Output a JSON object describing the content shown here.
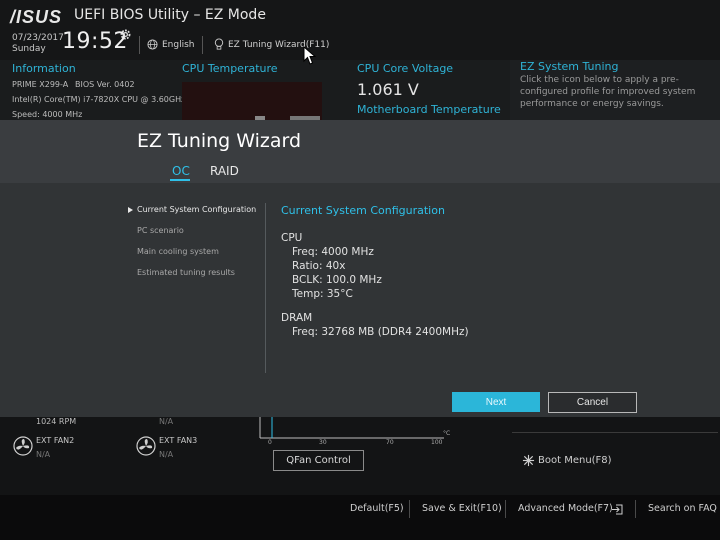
{
  "topbar": {
    "logo": "/ISUS",
    "title": "UEFI BIOS Utility – EZ Mode",
    "date": "07/23/2017",
    "day": "Sunday",
    "time": "19:52",
    "language": "English",
    "wizard_link": "EZ Tuning Wizard(F11)"
  },
  "dashboard": {
    "info_title": "Information",
    "board": "PRIME X299-A",
    "bios_ver": "BIOS Ver. 0402",
    "cpu": "Intel(R) Core(TM) i7-7820X CPU @ 3.60GHz",
    "speed": "Speed: 4000 MHz",
    "cpu_temp_title": "CPU Temperature",
    "cpu_voltage_title": "CPU Core Voltage",
    "cpu_voltage": "1.061 V",
    "mb_temp_title": "Motherboard Temperature",
    "tuning_title": "EZ System Tuning",
    "tuning_desc": "Click the icon below to apply a pre-configured profile for improved system performance or energy savings.",
    "fan_rpm_partial": "1024 RPM",
    "fan_na_partial": "N/A",
    "fans": [
      {
        "label": "EXT FAN2",
        "value": "N/A"
      },
      {
        "label": "EXT FAN3",
        "value": "N/A"
      }
    ],
    "chart_ticks": [
      "0",
      "30",
      "70",
      "100"
    ],
    "chart_unit": "°C",
    "qfan_label": "QFan Control",
    "boot_menu": "Boot Menu(F8)"
  },
  "modal": {
    "title": "EZ Tuning Wizard",
    "tabs": [
      {
        "label": "OC",
        "active": true
      },
      {
        "label": "RAID",
        "active": false
      }
    ],
    "steps": [
      "Current System Configuration",
      "PC scenario",
      "Main cooling system",
      "Estimated tuning results"
    ],
    "content_title": "Current System Configuration",
    "cpu": {
      "heading": "CPU",
      "freq": "Freq: 4000 MHz",
      "ratio": "Ratio: 40x",
      "bclk": "BCLK: 100.0 MHz",
      "temp": "Temp: 35°C"
    },
    "dram": {
      "heading": "DRAM",
      "freq": "Freq: 32768 MB (DDR4 2400MHz)"
    },
    "next_label": "Next",
    "cancel_label": "Cancel"
  },
  "bottombar": {
    "default": "Default(F5)",
    "save_exit": "Save & Exit(F10)",
    "advanced": "Advanced Mode(F7)",
    "search": "Search on FAQ"
  },
  "colors": {
    "accent": "#2fc0e8",
    "modal_bg": "#313436",
    "next_button": "#2bb6d9"
  }
}
